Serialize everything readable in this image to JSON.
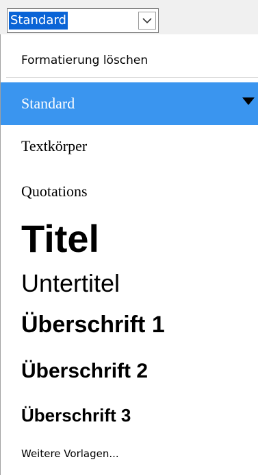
{
  "combo": {
    "value": "Standard",
    "button_icon": "chevron-down-icon"
  },
  "dropdown": {
    "clear_formatting": "Formatierung löschen",
    "items": [
      {
        "label": "Standard",
        "selected": true,
        "indicator_icon": "triangle-down-icon"
      },
      {
        "label": "Textkörper"
      },
      {
        "label": "Quotations"
      },
      {
        "label": "Titel"
      },
      {
        "label": "Untertitel"
      },
      {
        "label": "Überschrift 1"
      },
      {
        "label": "Überschrift 2"
      },
      {
        "label": "Überschrift 3"
      }
    ],
    "more_styles": "Weitere Vorlagen..."
  },
  "colors": {
    "selection": "#3a95ef",
    "combo_highlight": "#0a64d6"
  }
}
